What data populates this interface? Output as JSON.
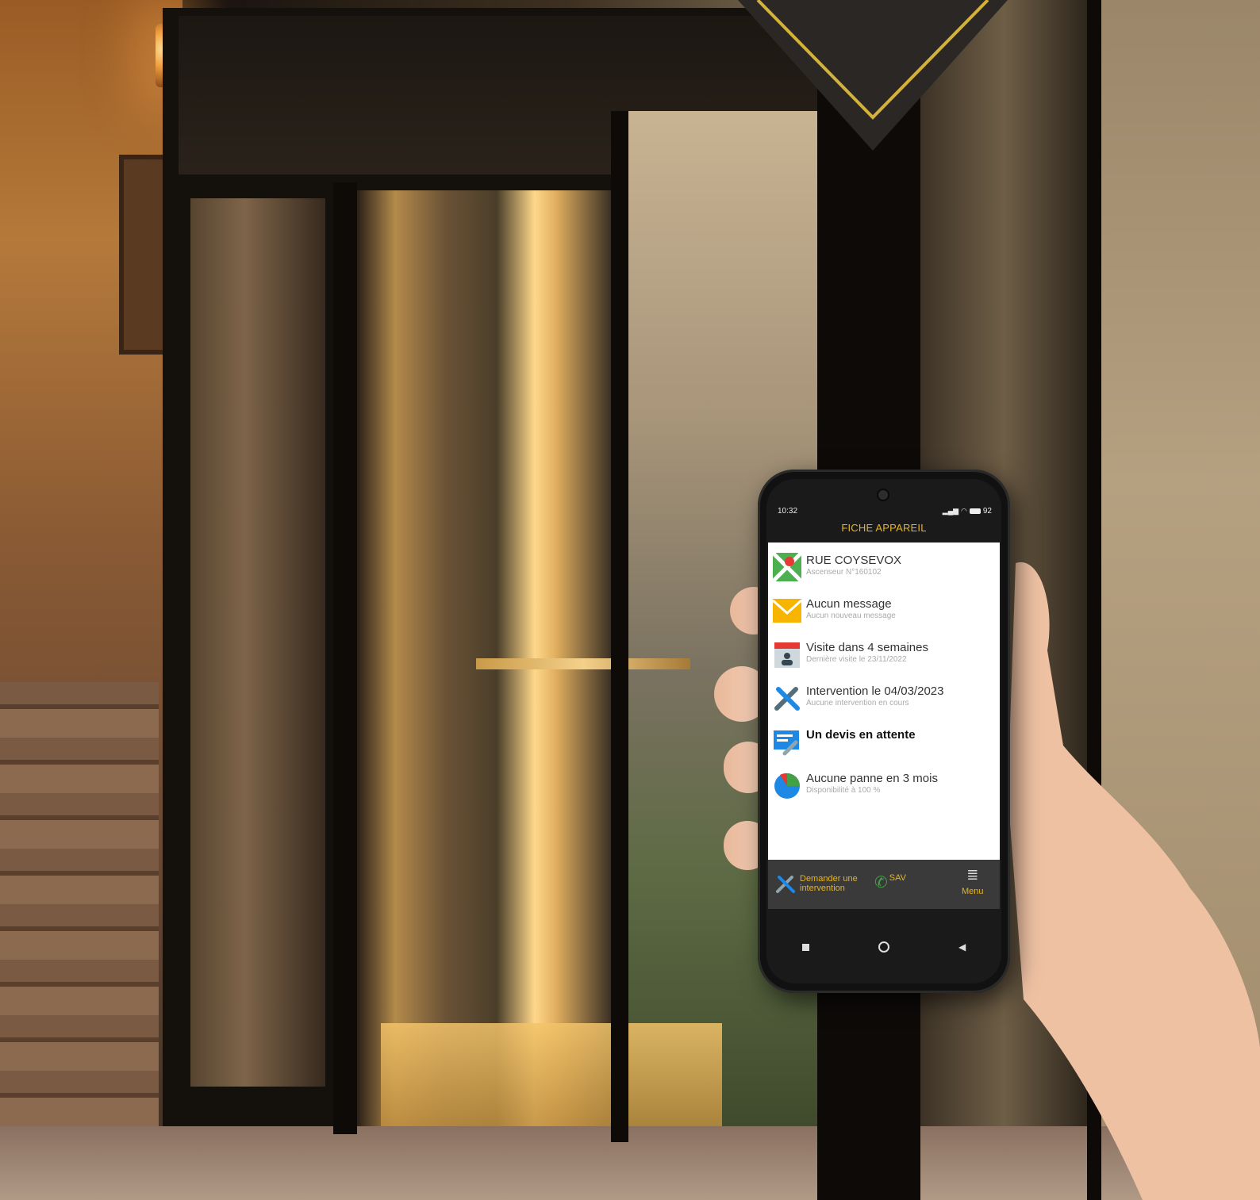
{
  "statusbar": {
    "time": "10:32",
    "battery": "92"
  },
  "header": {
    "title": "FICHE APPAREIL"
  },
  "rows": [
    {
      "title": "RUE COYSEVOX",
      "subtitle": "Ascenseur N°160102",
      "icon": "map-icon"
    },
    {
      "title": "Aucun message",
      "subtitle": "Aucun nouveau message",
      "icon": "envelope-icon"
    },
    {
      "title": "Visite dans 4 semaines",
      "subtitle": "Dernière visite le 23/11/2022",
      "icon": "calendar-icon"
    },
    {
      "title": "Intervention le 04/03/2023",
      "subtitle": "Aucune intervention en cours",
      "icon": "tools-icon"
    },
    {
      "title": "Un devis en attente",
      "subtitle": "",
      "icon": "quote-icon"
    },
    {
      "title": "Aucune panne en 3 mois",
      "subtitle": "Disponibilité à 100 %",
      "icon": "pie-chart-icon"
    }
  ],
  "bottombar": {
    "request_line1": "Demander une",
    "request_line2": "intervention",
    "sav": "SAV",
    "menu": "Menu"
  },
  "colors": {
    "accent": "#e6b422",
    "bar": "#3a3a3a"
  }
}
